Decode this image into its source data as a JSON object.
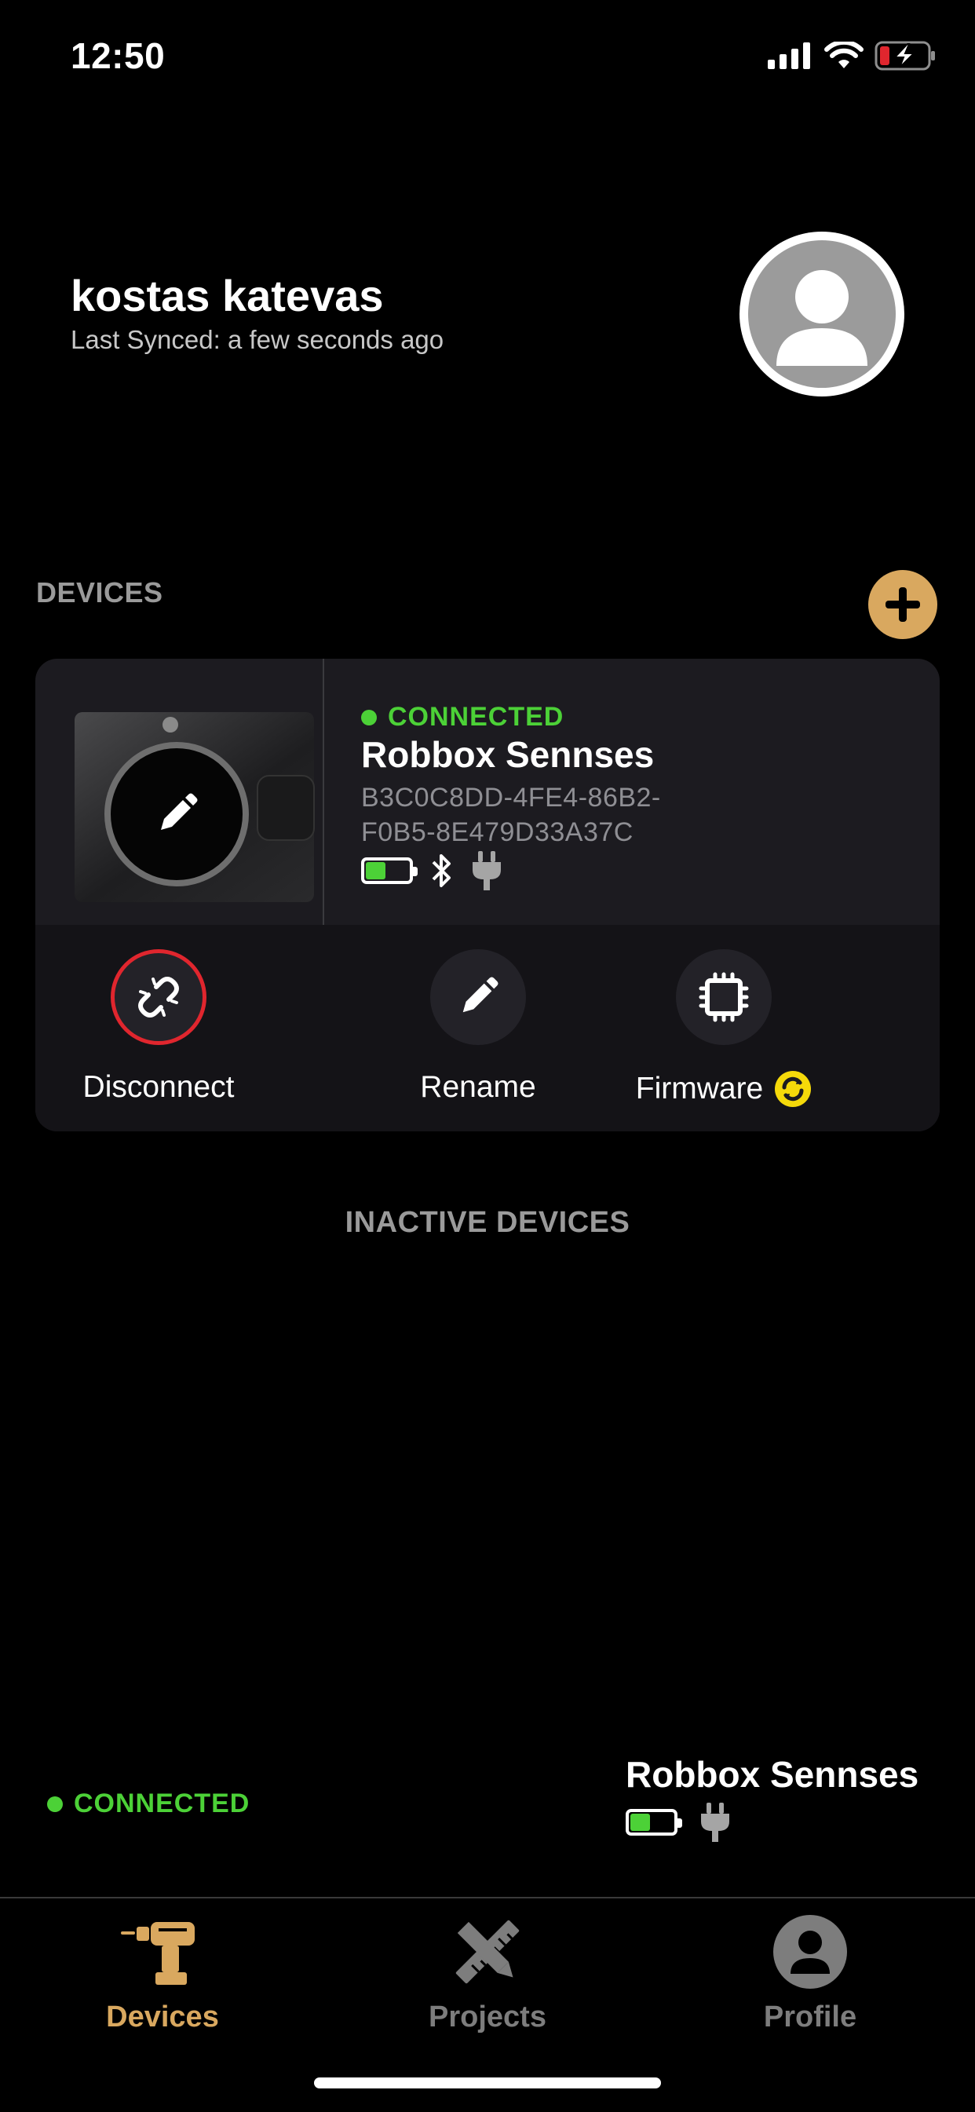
{
  "status_bar": {
    "time": "12:50"
  },
  "header": {
    "user_name": "kostas katevas",
    "last_synced": "Last Synced: a few seconds ago"
  },
  "devices_section": {
    "title": "DEVICES"
  },
  "device_card": {
    "status": "CONNECTED",
    "name": "Robbox Sennses",
    "id_line1": "B3C0C8DD-4FE4-86B2-",
    "id_line2": "F0B5-8E479D33A37C",
    "battery_level": 0.5,
    "actions": {
      "disconnect": "Disconnect",
      "rename": "Rename",
      "firmware": "Firmware"
    }
  },
  "inactive_section": {
    "title": "INACTIVE DEVICES"
  },
  "bottom_status": {
    "status": "CONNECTED",
    "name": "Robbox Sennses",
    "battery_level": 0.5
  },
  "tabs": [
    {
      "label": "Devices",
      "icon": "drill-icon",
      "active": true
    },
    {
      "label": "Projects",
      "icon": "pencil-ruler-icon",
      "active": false
    },
    {
      "label": "Profile",
      "icon": "user-circle-icon",
      "active": false
    }
  ],
  "colors": {
    "accent": "#d9a85f",
    "connected": "#4cd137",
    "disconnect_ring": "#e0262e",
    "firmware_badge": "#f5d90a",
    "low_battery": "#e0262e"
  }
}
